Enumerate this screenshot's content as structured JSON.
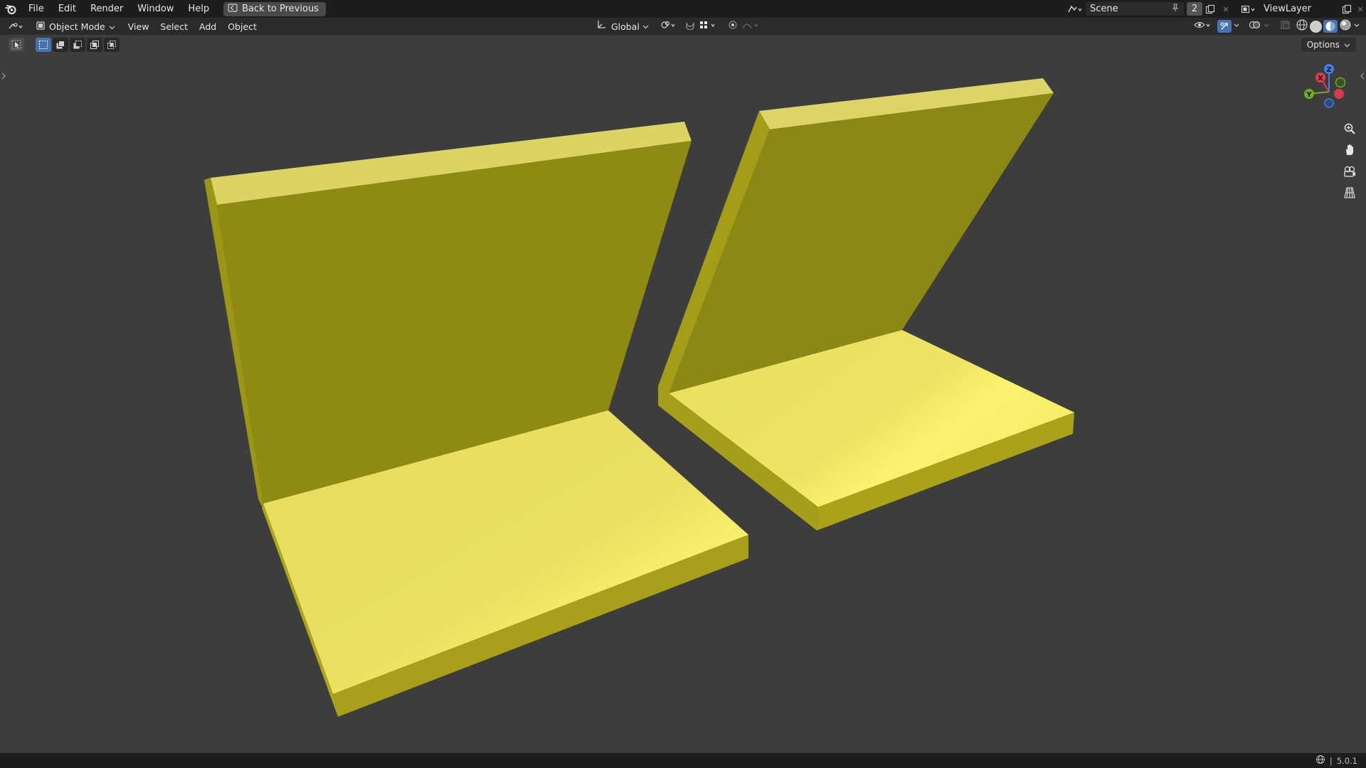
{
  "topbar": {
    "menus": [
      "File",
      "Edit",
      "Render",
      "Window",
      "Help"
    ],
    "back_button": "Back to Previous",
    "scene_name": "Scene",
    "scene_count": "2",
    "view_layer": "ViewLayer"
  },
  "header": {
    "mode": "Object Mode",
    "menus": [
      "View",
      "Select",
      "Add",
      "Object"
    ],
    "transform_orientation": "Global"
  },
  "toolbar": {
    "options_label": "Options"
  },
  "gizmo": {
    "x_label": "X",
    "y_label": "Y",
    "z_label": "Z"
  },
  "statusbar": {
    "version": "5.0.1"
  },
  "colors": {
    "accent_blue": "#4772b3",
    "object_yellow": "#e8e05a",
    "axis_x": "#e63b4e",
    "axis_y": "#71ad20",
    "axis_z": "#3e81e6"
  }
}
